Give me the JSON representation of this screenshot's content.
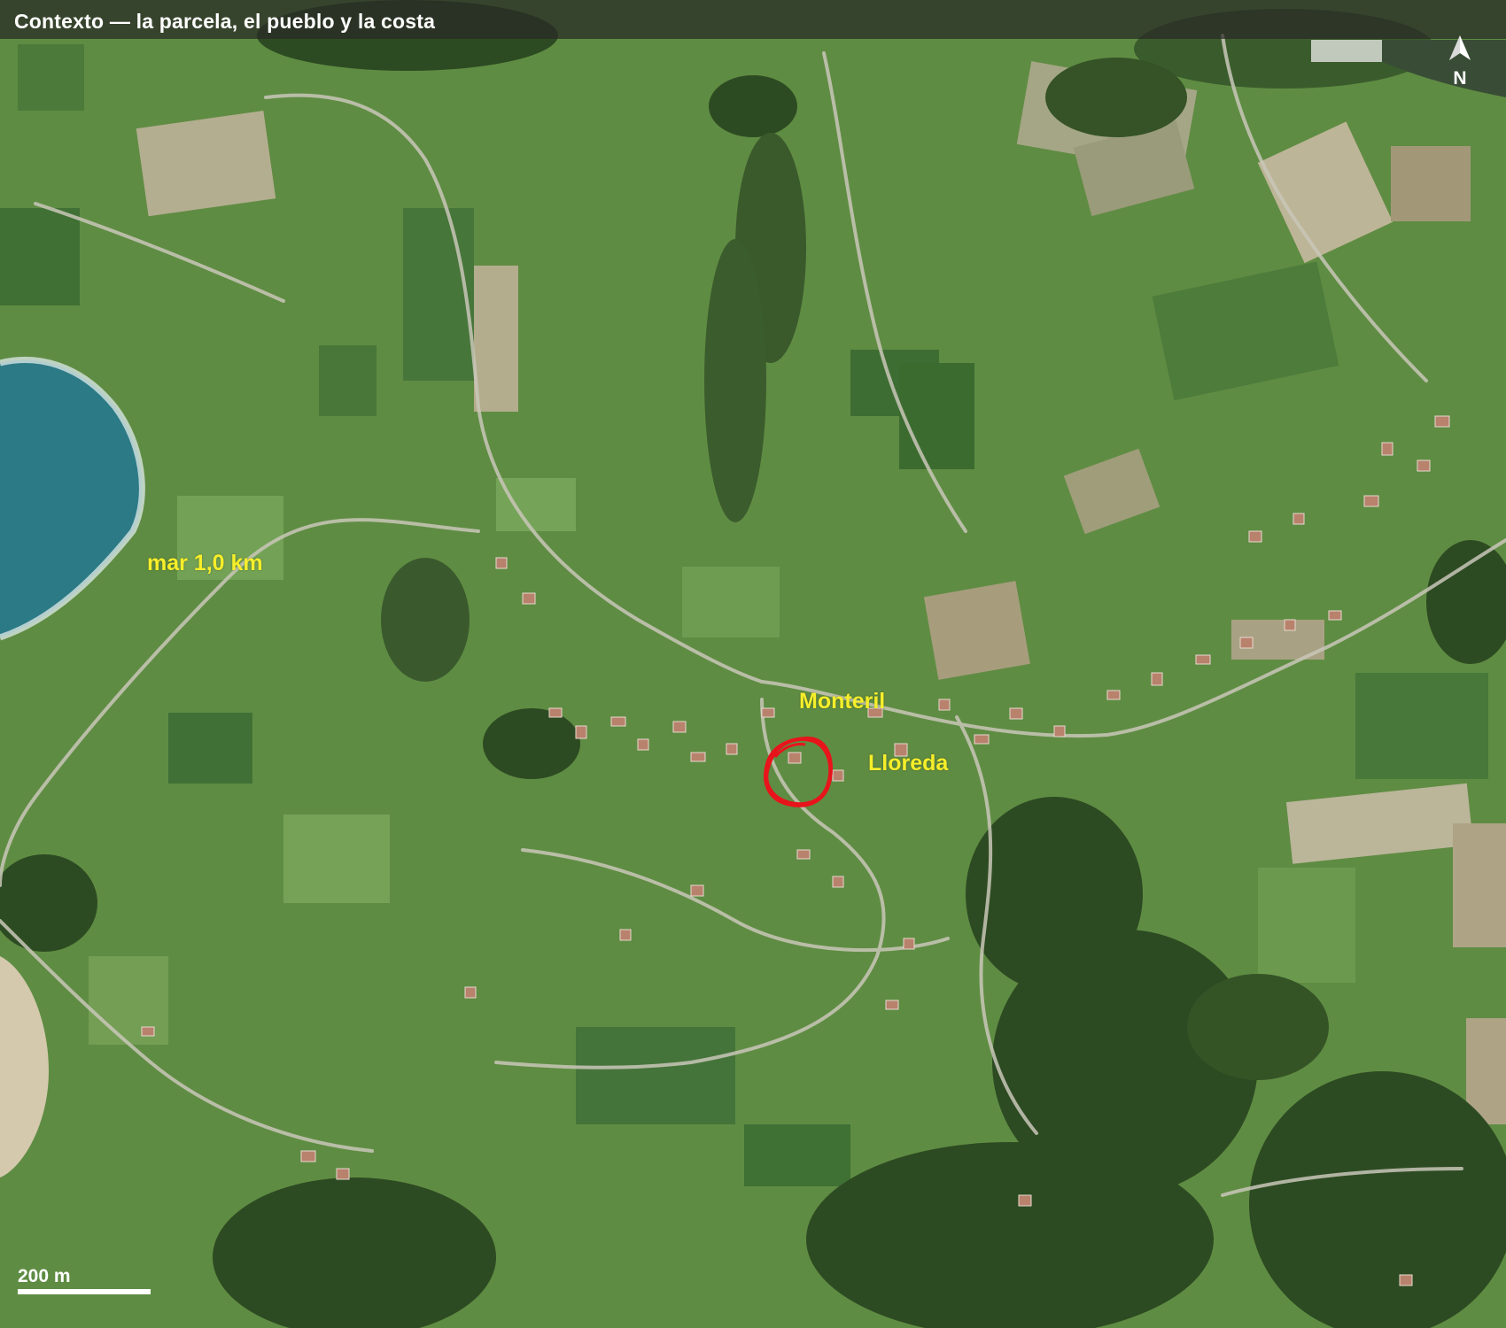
{
  "title": "Contexto — la parcela, el pueblo y la costa",
  "north_label": "N",
  "labels": {
    "sea_distance": "mar 1,0 km",
    "place_1": "Monteril",
    "place_2": "Lloreda"
  },
  "scale_bar": {
    "label": "200 m"
  },
  "icons": {
    "north": "north-arrow-icon",
    "parcel": "parcel-outline"
  },
  "colors": {
    "label_yellow": "#f6ee2a",
    "parcel_red": "#e8141b",
    "title_bar": "#2b2b29",
    "meadow": "#6a9a4a",
    "sea": "#2e7f8c"
  }
}
